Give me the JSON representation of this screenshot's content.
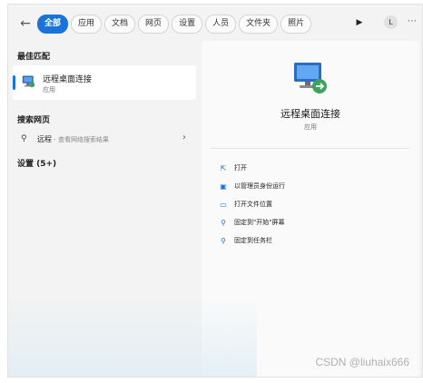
{
  "filters": {
    "tabs": [
      "全部",
      "应用",
      "文档",
      "网页",
      "设置",
      "人员",
      "文件夹",
      "照片"
    ],
    "active_index": 0,
    "avatar_letter": "L"
  },
  "left": {
    "best_match_title": "最佳匹配",
    "best_match": {
      "name": "远程桌面连接",
      "type": "应用"
    },
    "search_web_title": "搜索网页",
    "web_query": "远程",
    "web_hint": " - 查看网络搜索结果",
    "settings_title": "设置 (5+)"
  },
  "detail": {
    "name": "远程桌面连接",
    "type": "应用",
    "actions": [
      {
        "label": "打开",
        "icon": "open-external-icon",
        "glyph": "⇱"
      },
      {
        "label": "以管理员身份运行",
        "icon": "admin-shield-icon",
        "glyph": "▣"
      },
      {
        "label": "打开文件位置",
        "icon": "folder-icon",
        "glyph": "▭"
      },
      {
        "label": "固定到\"开始\"屏幕",
        "icon": "pin-icon",
        "glyph": "⚲"
      },
      {
        "label": "固定到任务栏",
        "icon": "pin-icon",
        "glyph": "⚲"
      }
    ]
  },
  "colors": {
    "accent": "#1a73d9",
    "panel_bg": "#f3f3f3"
  },
  "watermark": "CSDN @liuhaix666"
}
